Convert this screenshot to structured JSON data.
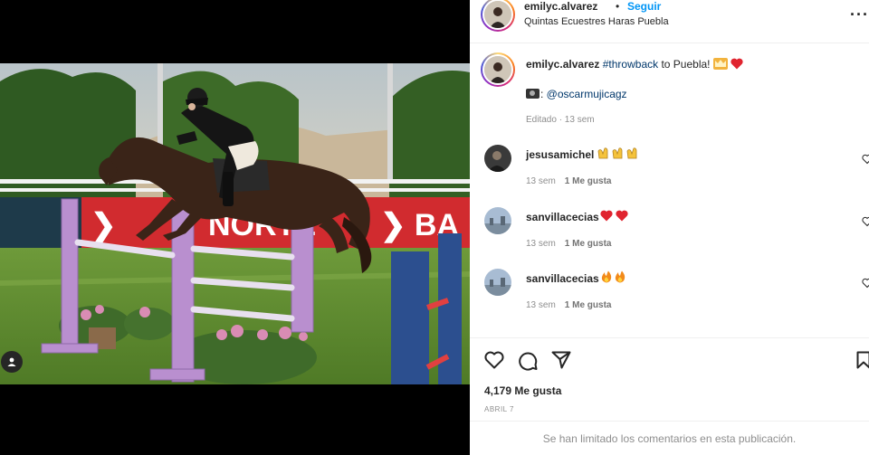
{
  "post": {
    "author": "emilyc.alvarez",
    "separator": "•",
    "follow_label": "Seguir",
    "location": "Quintas Ecuestres Haras Puebla",
    "more_label": "···"
  },
  "caption": {
    "username": "emilyc.alvarez",
    "hashtag": "#throwback",
    "text": " to Puebla! ",
    "emoji": [
      "crown",
      "red-heart"
    ],
    "credit_prefix": ": ",
    "credit_handle": "@oscarmujicagz",
    "edited": "Editado · 13 sem"
  },
  "comments": [
    {
      "username": "jesusamichel",
      "emoji": [
        "raising-hands",
        "raising-hands",
        "raising-hands"
      ],
      "time": "13 sem",
      "likes": "1 Me gusta"
    },
    {
      "username": "sanvillacecias",
      "emoji": [
        "red-heart",
        "red-heart"
      ],
      "time": "13 sem",
      "likes": "1 Me gusta"
    },
    {
      "username": "sanvillacecias",
      "emoji": [
        "fire",
        "fire"
      ],
      "time": "13 sem",
      "likes": "1 Me gusta"
    }
  ],
  "footer": {
    "likes_count": "4,179 Me gusta",
    "date": "ABRIL 7",
    "comments_limited": "Se han limitado los comentarios en esta publicación."
  },
  "icons": [
    "heart-icon",
    "comment-icon",
    "share-icon",
    "bookmark-icon",
    "more-icon",
    "user-tag-icon",
    "camera-icon"
  ],
  "colors": {
    "accent": "#0095f6",
    "link": "#00376b",
    "muted": "#8e8e8e",
    "heart": "#e0242f"
  }
}
